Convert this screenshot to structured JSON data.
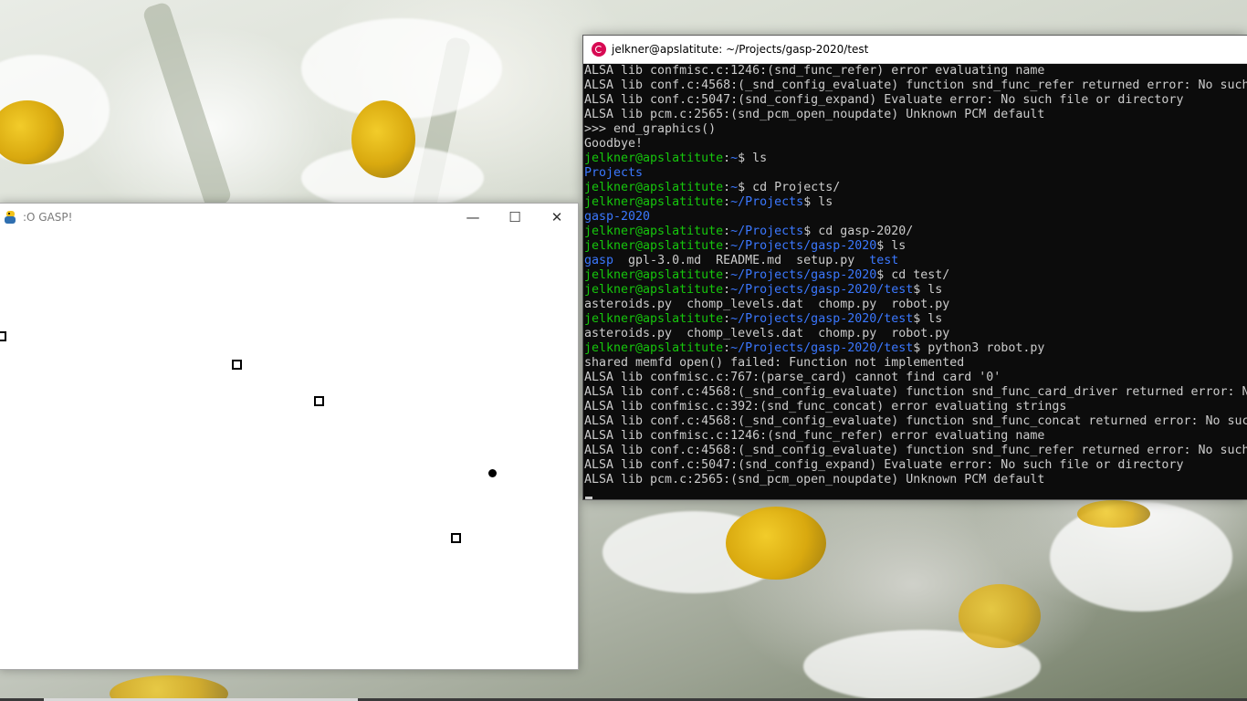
{
  "terminal": {
    "title": "jelkner@apslatitute: ~/Projects/gasp-2020/test",
    "colors": {
      "background": "#0c0c0c",
      "text": "#cccccc",
      "user": "#16c60c",
      "path": "#3b78ff"
    },
    "lines": [
      "ALSA lib confmisc.c:1246:(snd_func_refer) error evaluating name",
      "ALSA lib conf.c:4568:(_snd_config_evaluate) function snd_func_refer returned error: No such",
      "ALSA lib conf.c:5047:(snd_config_expand) Evaluate error: No such file or directory",
      "ALSA lib pcm.c:2565:(snd_pcm_open_noupdate) Unknown PCM default",
      ">>> end_graphics()",
      "Goodbye!",
      {
        "user": "jelkner@apslatitute",
        "sep": ":",
        "path": "~",
        "cmd": "$ ls"
      },
      {
        "dir": "Projects"
      },
      {
        "user": "jelkner@apslatitute",
        "sep": ":",
        "path": "~",
        "cmd": "$ cd Projects/"
      },
      {
        "user": "jelkner@apslatitute",
        "sep": ":",
        "path": "~/Projects",
        "cmd": "$ ls"
      },
      {
        "dir": "gasp-2020"
      },
      {
        "user": "jelkner@apslatitute",
        "sep": ":",
        "path": "~/Projects",
        "cmd": "$ cd gasp-2020/"
      },
      {
        "user": "jelkner@apslatitute",
        "sep": ":",
        "path": "~/Projects/gasp-2020",
        "cmd": "$ ls"
      },
      {
        "mixed": [
          {
            "t": "gasp",
            "dir": true
          },
          {
            "t": "  gpl-3.0.md  README.md  setup.py  "
          },
          {
            "t": "test",
            "dir": true
          }
        ]
      },
      {
        "user": "jelkner@apslatitute",
        "sep": ":",
        "path": "~/Projects/gasp-2020",
        "cmd": "$ cd test/"
      },
      {
        "user": "jelkner@apslatitute",
        "sep": ":",
        "path": "~/Projects/gasp-2020/test",
        "cmd": "$ ls"
      },
      "asteroids.py  chomp_levels.dat  chomp.py  robot.py",
      {
        "user": "jelkner@apslatitute",
        "sep": ":",
        "path": "~/Projects/gasp-2020/test",
        "cmd": "$ ls"
      },
      "asteroids.py  chomp_levels.dat  chomp.py  robot.py",
      {
        "user": "jelkner@apslatitute",
        "sep": ":",
        "path": "~/Projects/gasp-2020/test",
        "cmd": "$ python3 robot.py"
      },
      "shared memfd open() failed: Function not implemented",
      "ALSA lib confmisc.c:767:(parse_card) cannot find card '0'",
      "ALSA lib conf.c:4568:(_snd_config_evaluate) function snd_func_card_driver returned error: N",
      "ALSA lib confmisc.c:392:(snd_func_concat) error evaluating strings",
      "ALSA lib conf.c:4568:(_snd_config_evaluate) function snd_func_concat returned error: No suc",
      "ALSA lib confmisc.c:1246:(snd_func_refer) error evaluating name",
      "ALSA lib conf.c:4568:(_snd_config_evaluate) function snd_func_refer returned error: No such",
      "ALSA lib conf.c:5047:(snd_config_expand) Evaluate error: No such file or directory",
      "ALSA lib pcm.c:2565:(snd_pcm_open_noupdate) Unknown PCM default"
    ]
  },
  "gasp_window": {
    "title": ":O GASP!",
    "icon": "pygame-snake-icon",
    "buttons": {
      "minimize": "—",
      "maximize": "☐",
      "close": "✕"
    },
    "objects": [
      {
        "kind": "robot-square"
      },
      {
        "kind": "robot-square"
      },
      {
        "kind": "robot-square"
      },
      {
        "kind": "player-dot"
      },
      {
        "kind": "robot-square"
      }
    ]
  }
}
